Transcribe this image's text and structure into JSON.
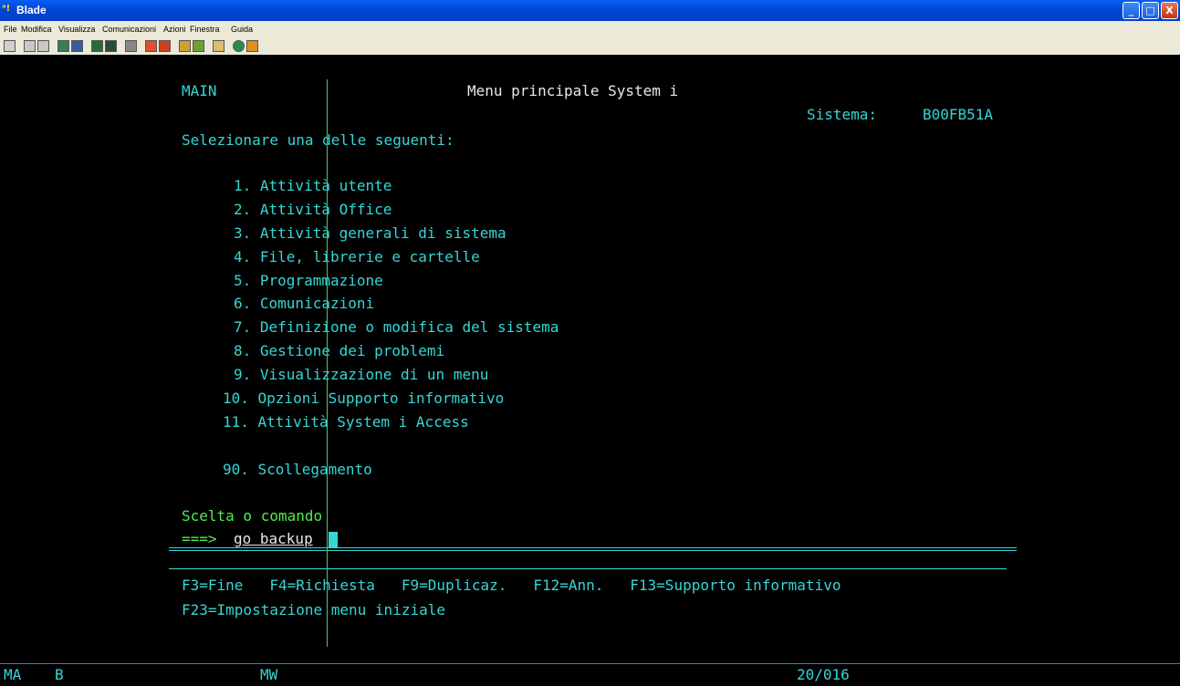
{
  "window": {
    "title": "Blade",
    "app_icon": "ᵃ!",
    "minimize": "_",
    "maximize": "□",
    "close": "X"
  },
  "menubar": {
    "items": [
      "File",
      "Modifica",
      "Visualizza",
      "Comunicazioni",
      "Azioni",
      "Finestra",
      "Guida"
    ]
  },
  "toolbar": {
    "icons": [
      "print-screen-icon",
      "copy-icon",
      "paste-icon",
      "send-icon",
      "receive-icon",
      "display-icon",
      "keyboard-icon",
      "macro-icon",
      "record-icon",
      "play-icon",
      "transfer-send-icon",
      "transfer-receive-icon",
      "clipboard-icon",
      "globe-icon",
      "help-icon"
    ]
  },
  "screen": {
    "menu_id": "MAIN",
    "title": "Menu principale System i",
    "system_label": "Sistema:",
    "system_name": "B00FB51A",
    "prompt": "Selezionare una delle seguenti:",
    "options": [
      "1. Attività utente",
      "2. Attività Office",
      "3. Attività generali di sistema",
      "4. File, librerie e cartelle",
      "5. Programmazione",
      "6. Comunicazioni",
      "7. Definizione o modifica del sistema",
      "8. Gestione dei problemi",
      "9. Visualizzazione di un menu",
      "10. Opzioni Supporto informativo",
      "11. Attività System i Access"
    ],
    "signoff": "90. Scollegamento",
    "command_label": "Scelta o comando",
    "command_arrow": "===>",
    "command_value": "go backup",
    "function_keys_1": "F3=Fine   F4=Richiesta   F9=Duplicaz.   F12=Ann.   F13=Supporto informativo",
    "function_keys_2": "F23=Impostazione menu iniziale"
  },
  "status": {
    "mode": "MA",
    "indicator": "B",
    "session": "MW",
    "cursor_pos": "20/016"
  },
  "colors": {
    "green": "#4ef04e",
    "cyan": "#36d6d6",
    "white": "#e8e8e8",
    "background": "#000000"
  }
}
